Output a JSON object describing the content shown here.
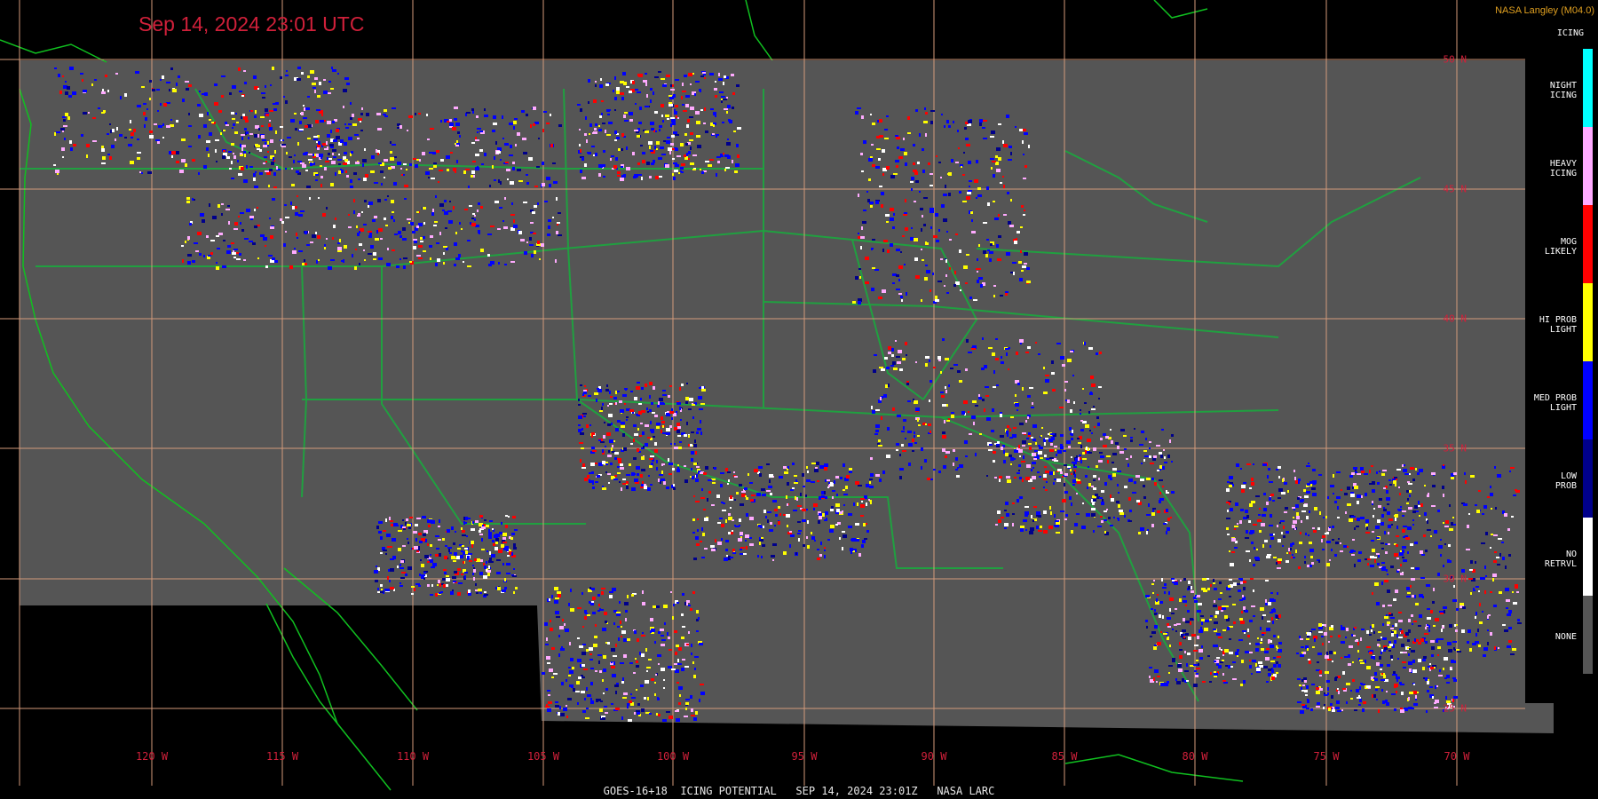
{
  "title": "Sep 14, 2024 23:01 UTC",
  "credit": "NASA Langley (M04.0)",
  "footer": "GOES-16+18  ICING POTENTIAL   SEP 14, 2024 23:01Z   NASA LARC",
  "legend": {
    "title": "ICING",
    "items": [
      {
        "label": "NIGHT\nICING",
        "color": "#00ffff"
      },
      {
        "label": "HEAVY\nICING",
        "color": "#ffaaff"
      },
      {
        "label": "MOG\nLIKELY",
        "color": "#ff0000"
      },
      {
        "label": "HI PROB\nLIGHT",
        "color": "#ffff00"
      },
      {
        "label": "MED PROB\nLIGHT",
        "color": "#0000ff"
      },
      {
        "label": "LOW\nPROB",
        "color": "#00008b"
      },
      {
        "label": "NO\nRETRVL",
        "color": "#ffffff"
      },
      {
        "label": "NONE",
        "color": "#555555"
      }
    ]
  },
  "longitude_labels": [
    "120 W",
    "115 W",
    "110 W",
    "105 W",
    "100 W",
    "95 W",
    "90 W",
    "85 W",
    "80 W",
    "75 W",
    "70 W"
  ],
  "latitude_labels": [
    "50 N",
    "45 N",
    "40 N",
    "35 N",
    "30 N",
    "25 N"
  ],
  "colors": {
    "grid": "#d49a7a",
    "borders": "#20a040",
    "coast": "#00c000",
    "data_area": "#555555",
    "title": "#d0203a"
  }
}
